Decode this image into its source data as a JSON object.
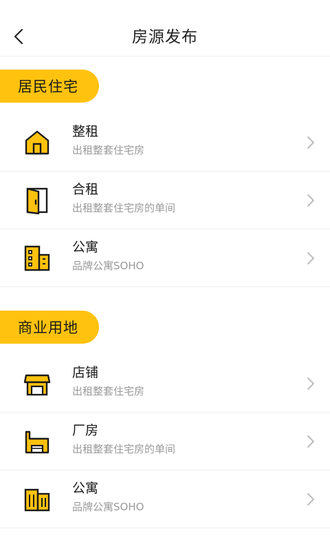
{
  "header": {
    "title": "房源发布",
    "back_icon": "chevron-left-icon"
  },
  "colors": {
    "accent": "#FFC20E",
    "divider": "#EEEEEE",
    "subtext": "#9A9A9A"
  },
  "sections": [
    {
      "label": "居民住宅",
      "items": [
        {
          "title": "整租",
          "subtitle": "出租整套住宅房",
          "icon": "house-icon"
        },
        {
          "title": "合租",
          "subtitle": "出租整套住宅房的单间",
          "icon": "door-icon"
        },
        {
          "title": "公寓",
          "subtitle": "品牌公寓SOHO",
          "icon": "apartment-building-icon"
        }
      ]
    },
    {
      "label": "商业用地",
      "items": [
        {
          "title": "店铺",
          "subtitle": "出租整套住宅房",
          "icon": "storefront-icon"
        },
        {
          "title": "厂房",
          "subtitle": "出租整套住宅房的单间",
          "icon": "factory-icon"
        },
        {
          "title": "公寓",
          "subtitle": "品牌公寓SOHO",
          "icon": "office-building-icon"
        }
      ]
    }
  ]
}
